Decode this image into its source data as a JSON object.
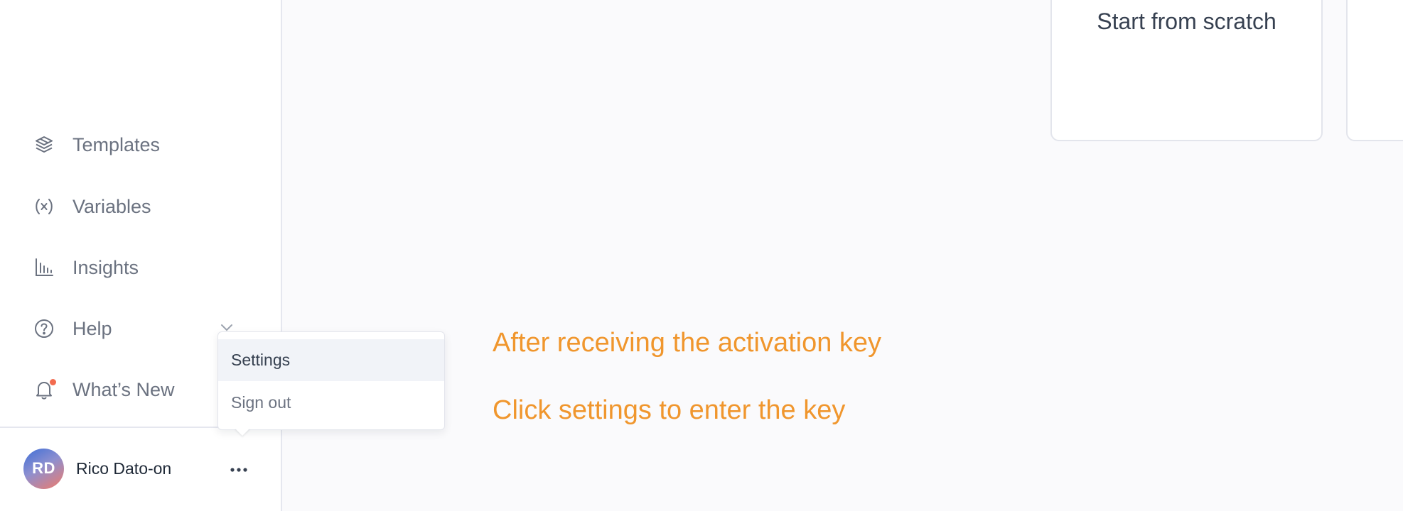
{
  "sidebar": {
    "items": [
      {
        "label": "Templates",
        "icon": "templates-icon"
      },
      {
        "label": "Variables",
        "icon": "variables-icon"
      },
      {
        "label": "Insights",
        "icon": "insights-icon"
      },
      {
        "label": "Help",
        "icon": "help-icon"
      },
      {
        "label": "What’s New",
        "icon": "bell-icon",
        "has_notification": true
      }
    ],
    "user": {
      "initials": "RD",
      "name": "Rico Dato-on"
    }
  },
  "user_menu": {
    "items": [
      {
        "label": "Settings",
        "highlighted": true
      },
      {
        "label": "Sign out",
        "highlighted": false
      }
    ]
  },
  "main": {
    "cards": [
      {
        "title": "Start from scratch"
      }
    ],
    "annotations": [
      "After receiving the activation key",
      "Click settings to enter the key"
    ]
  },
  "colors": {
    "annotation": "#f0962d",
    "notification_dot": "#f26b4f",
    "sidebar_text": "#6b7280",
    "menu_highlight": "#f1f3f8"
  }
}
